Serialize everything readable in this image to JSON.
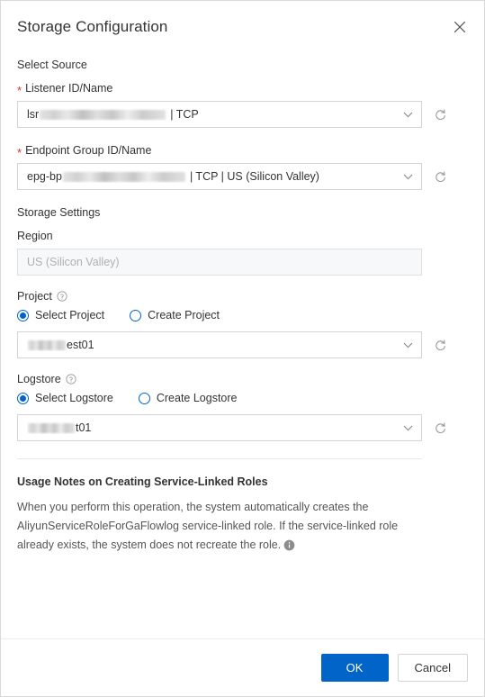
{
  "dialog": {
    "title": "Storage Configuration",
    "close_icon": "close-icon"
  },
  "select_source": {
    "section_label": "Select Source",
    "listener": {
      "label": "Listener ID/Name",
      "required_marker": "*",
      "value_prefix": "lsr",
      "value_suffix": "| TCP",
      "redacted": true,
      "refresh_icon": "refresh-icon",
      "caret_icon": "chevron-down-icon"
    },
    "endpoint_group": {
      "label": "Endpoint Group ID/Name",
      "required_marker": "*",
      "value_prefix": "epg-bp",
      "value_suffix": "| TCP | US (Silicon Valley)",
      "redacted": true,
      "refresh_icon": "refresh-icon",
      "caret_icon": "chevron-down-icon"
    }
  },
  "storage_settings": {
    "section_label": "Storage Settings",
    "region": {
      "label": "Region",
      "value": "US (Silicon Valley)",
      "disabled": true
    },
    "project": {
      "label": "Project",
      "help_icon": "question-circle-icon",
      "options": [
        {
          "label": "Select Project",
          "checked": true
        },
        {
          "label": "Create Project",
          "checked": false
        }
      ],
      "value_suffix": "est01",
      "redacted": true,
      "refresh_icon": "refresh-icon",
      "caret_icon": "chevron-down-icon"
    },
    "logstore": {
      "label": "Logstore",
      "help_icon": "question-circle-icon",
      "options": [
        {
          "label": "Select Logstore",
          "checked": true
        },
        {
          "label": "Create Logstore",
          "checked": false
        }
      ],
      "value_suffix": "t01",
      "redacted": true,
      "refresh_icon": "refresh-icon",
      "caret_icon": "chevron-down-icon"
    }
  },
  "usage_notes": {
    "title": "Usage Notes on Creating Service-Linked Roles",
    "body": "When you perform this operation, the system automatically creates the AliyunServiceRoleForGaFlowlog service-linked role. If the service-linked role already exists, the system does not recreate the role.",
    "info_icon": "info-circle-icon"
  },
  "footer": {
    "ok_label": "OK",
    "cancel_label": "Cancel"
  },
  "colors": {
    "primary": "#0064c8",
    "required": "#d93026",
    "text": "#333333",
    "border": "#d4d4d4"
  }
}
